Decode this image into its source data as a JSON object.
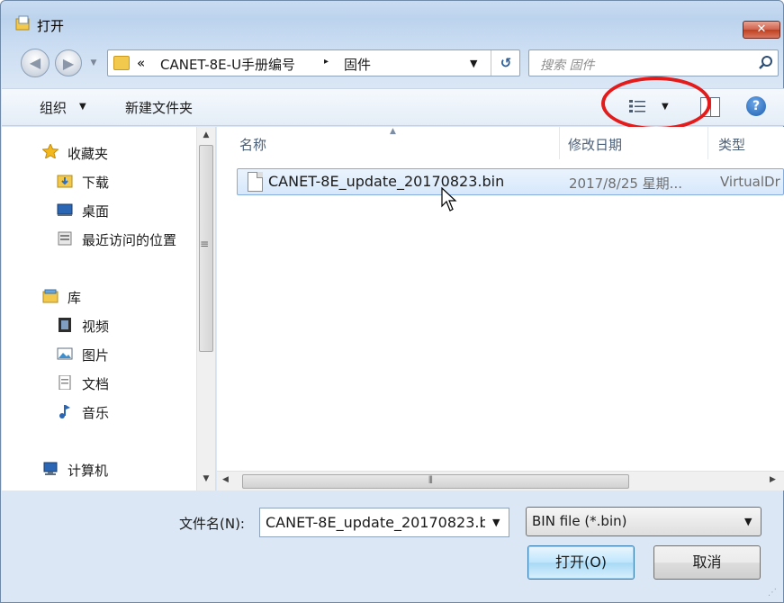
{
  "window": {
    "title": "打开",
    "close_label": "✕"
  },
  "address_bar": {
    "overflow_chevron": "«",
    "crumbs": [
      "CANET-8E-U手册编号",
      "固件"
    ],
    "separator": "▸"
  },
  "search": {
    "placeholder": "搜索 固件"
  },
  "toolbar": {
    "organize_label": "组织",
    "new_folder_label": "新建文件夹",
    "help_label": "?"
  },
  "navigation_pane": {
    "favorites": {
      "label": "收藏夹",
      "items": [
        "下载",
        "桌面",
        "最近访问的位置"
      ]
    },
    "libraries": {
      "label": "库",
      "items": [
        "视频",
        "图片",
        "文档",
        "音乐"
      ]
    },
    "computer": {
      "label": "计算机"
    }
  },
  "file_list": {
    "columns": [
      "名称",
      "修改日期",
      "类型"
    ],
    "files": [
      {
        "name": "CANET-8E_update_20170823.bin",
        "modified": "2017/8/25 星期...",
        "type": "VirtualDr"
      }
    ]
  },
  "footer": {
    "filename_label": "文件名(N):",
    "filename_value": "CANET-8E_update_20170823.b",
    "filter_value": "BIN file (*.bin)",
    "open_label": "打开(O)",
    "cancel_label": "取消"
  },
  "colors": {
    "highlight_ring": "#e41b1b",
    "selection": "#d7e8fb",
    "window_chrome": "#bcd3ee"
  }
}
